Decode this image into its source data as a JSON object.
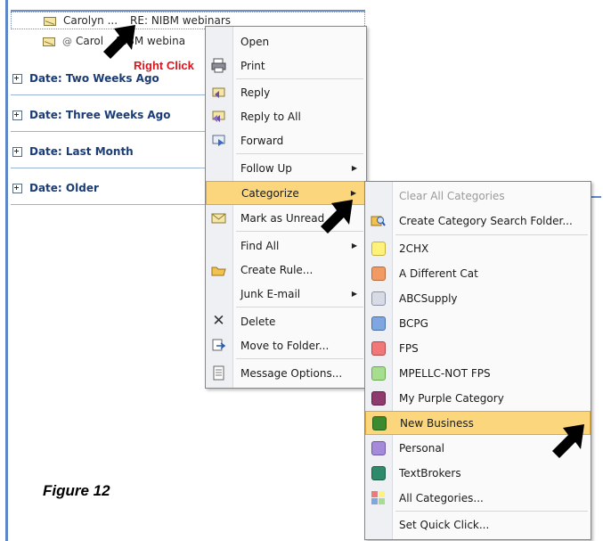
{
  "message_list": {
    "messages": [
      {
        "sender": "Carolyn ...",
        "subject": "RE: NIBM webinars"
      },
      {
        "sender": "Carol",
        "subject": "NIBM webina"
      }
    ],
    "groups": [
      {
        "label": "Date: Two Weeks Ago"
      },
      {
        "label": "Date: Three Weeks Ago"
      },
      {
        "label": "Date: Last Month"
      },
      {
        "label": "Date: Older"
      }
    ]
  },
  "annotation": {
    "right_click": "Right Click",
    "figure": "Figure 12"
  },
  "context_menu": {
    "items": [
      {
        "label": "Open",
        "icon": "none"
      },
      {
        "label": "Print",
        "icon": "printer-icon"
      },
      {
        "label": "Reply",
        "icon": "reply-icon"
      },
      {
        "label": "Reply to All",
        "icon": "reply-all-icon"
      },
      {
        "label": "Forward",
        "icon": "forward-icon"
      },
      {
        "label": "Follow Up",
        "icon": "none"
      },
      {
        "label": "Categorize",
        "icon": "none"
      },
      {
        "label": "Mark as Unread",
        "icon": "envelope-icon"
      },
      {
        "label": "Find All",
        "icon": "none"
      },
      {
        "label": "Create Rule...",
        "icon": "rule-icon"
      },
      {
        "label": "Junk E-mail",
        "icon": "none"
      },
      {
        "label": "Delete",
        "icon": "delete-icon"
      },
      {
        "label": "Move to Folder...",
        "icon": "move-icon"
      },
      {
        "label": "Message Options...",
        "icon": "options-icon"
      }
    ]
  },
  "categorize_menu": {
    "clear_label": "Clear All Categories",
    "search_folder_label": "Create Category Search Folder...",
    "categories": [
      {
        "label": "2CHX",
        "color": "#fff27a"
      },
      {
        "label": "A Different Cat",
        "color": "#f29a63"
      },
      {
        "label": "ABCSupply",
        "color": "#d7dbe6"
      },
      {
        "label": "BCPG",
        "color": "#7ea6e0"
      },
      {
        "label": "FPS",
        "color": "#f07878"
      },
      {
        "label": "MPELLC-NOT FPS",
        "color": "#a6dd8e"
      },
      {
        "label": "My Purple Category",
        "color": "#8e3a6e"
      },
      {
        "label": "New Business",
        "color": "#3c8a2e"
      },
      {
        "label": "Personal",
        "color": "#a48ad8"
      },
      {
        "label": "TextBrokers",
        "color": "#2e8a6a"
      }
    ],
    "all_categories_label": "All Categories...",
    "quick_click_label": "Set Quick Click..."
  }
}
